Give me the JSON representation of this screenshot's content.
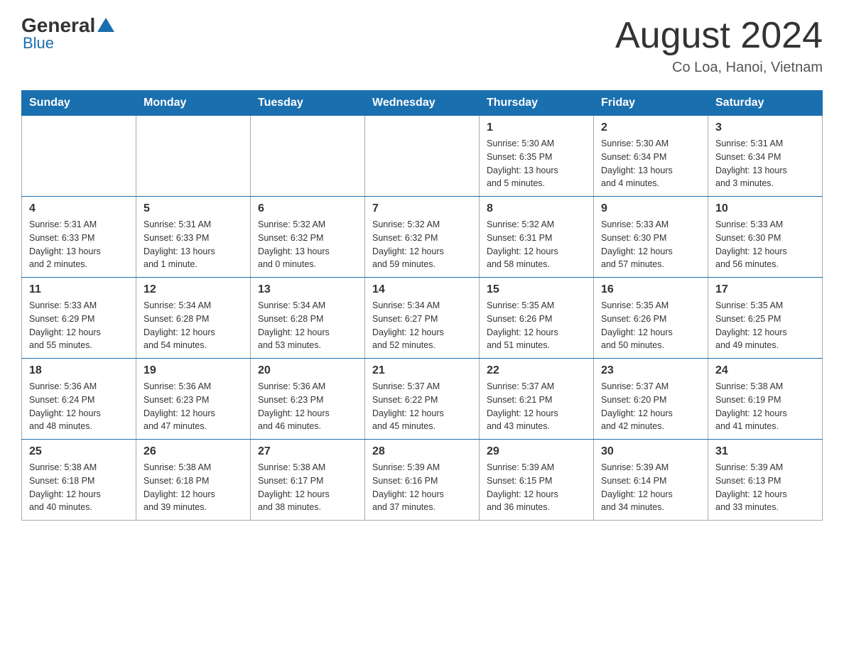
{
  "header": {
    "logo_general": "General",
    "logo_blue": "Blue",
    "month_title": "August 2024",
    "location": "Co Loa, Hanoi, Vietnam"
  },
  "days_of_week": [
    "Sunday",
    "Monday",
    "Tuesday",
    "Wednesday",
    "Thursday",
    "Friday",
    "Saturday"
  ],
  "weeks": [
    [
      {
        "day": "",
        "info": ""
      },
      {
        "day": "",
        "info": ""
      },
      {
        "day": "",
        "info": ""
      },
      {
        "day": "",
        "info": ""
      },
      {
        "day": "1",
        "info": "Sunrise: 5:30 AM\nSunset: 6:35 PM\nDaylight: 13 hours\nand 5 minutes."
      },
      {
        "day": "2",
        "info": "Sunrise: 5:30 AM\nSunset: 6:34 PM\nDaylight: 13 hours\nand 4 minutes."
      },
      {
        "day": "3",
        "info": "Sunrise: 5:31 AM\nSunset: 6:34 PM\nDaylight: 13 hours\nand 3 minutes."
      }
    ],
    [
      {
        "day": "4",
        "info": "Sunrise: 5:31 AM\nSunset: 6:33 PM\nDaylight: 13 hours\nand 2 minutes."
      },
      {
        "day": "5",
        "info": "Sunrise: 5:31 AM\nSunset: 6:33 PM\nDaylight: 13 hours\nand 1 minute."
      },
      {
        "day": "6",
        "info": "Sunrise: 5:32 AM\nSunset: 6:32 PM\nDaylight: 13 hours\nand 0 minutes."
      },
      {
        "day": "7",
        "info": "Sunrise: 5:32 AM\nSunset: 6:32 PM\nDaylight: 12 hours\nand 59 minutes."
      },
      {
        "day": "8",
        "info": "Sunrise: 5:32 AM\nSunset: 6:31 PM\nDaylight: 12 hours\nand 58 minutes."
      },
      {
        "day": "9",
        "info": "Sunrise: 5:33 AM\nSunset: 6:30 PM\nDaylight: 12 hours\nand 57 minutes."
      },
      {
        "day": "10",
        "info": "Sunrise: 5:33 AM\nSunset: 6:30 PM\nDaylight: 12 hours\nand 56 minutes."
      }
    ],
    [
      {
        "day": "11",
        "info": "Sunrise: 5:33 AM\nSunset: 6:29 PM\nDaylight: 12 hours\nand 55 minutes."
      },
      {
        "day": "12",
        "info": "Sunrise: 5:34 AM\nSunset: 6:28 PM\nDaylight: 12 hours\nand 54 minutes."
      },
      {
        "day": "13",
        "info": "Sunrise: 5:34 AM\nSunset: 6:28 PM\nDaylight: 12 hours\nand 53 minutes."
      },
      {
        "day": "14",
        "info": "Sunrise: 5:34 AM\nSunset: 6:27 PM\nDaylight: 12 hours\nand 52 minutes."
      },
      {
        "day": "15",
        "info": "Sunrise: 5:35 AM\nSunset: 6:26 PM\nDaylight: 12 hours\nand 51 minutes."
      },
      {
        "day": "16",
        "info": "Sunrise: 5:35 AM\nSunset: 6:26 PM\nDaylight: 12 hours\nand 50 minutes."
      },
      {
        "day": "17",
        "info": "Sunrise: 5:35 AM\nSunset: 6:25 PM\nDaylight: 12 hours\nand 49 minutes."
      }
    ],
    [
      {
        "day": "18",
        "info": "Sunrise: 5:36 AM\nSunset: 6:24 PM\nDaylight: 12 hours\nand 48 minutes."
      },
      {
        "day": "19",
        "info": "Sunrise: 5:36 AM\nSunset: 6:23 PM\nDaylight: 12 hours\nand 47 minutes."
      },
      {
        "day": "20",
        "info": "Sunrise: 5:36 AM\nSunset: 6:23 PM\nDaylight: 12 hours\nand 46 minutes."
      },
      {
        "day": "21",
        "info": "Sunrise: 5:37 AM\nSunset: 6:22 PM\nDaylight: 12 hours\nand 45 minutes."
      },
      {
        "day": "22",
        "info": "Sunrise: 5:37 AM\nSunset: 6:21 PM\nDaylight: 12 hours\nand 43 minutes."
      },
      {
        "day": "23",
        "info": "Sunrise: 5:37 AM\nSunset: 6:20 PM\nDaylight: 12 hours\nand 42 minutes."
      },
      {
        "day": "24",
        "info": "Sunrise: 5:38 AM\nSunset: 6:19 PM\nDaylight: 12 hours\nand 41 minutes."
      }
    ],
    [
      {
        "day": "25",
        "info": "Sunrise: 5:38 AM\nSunset: 6:18 PM\nDaylight: 12 hours\nand 40 minutes."
      },
      {
        "day": "26",
        "info": "Sunrise: 5:38 AM\nSunset: 6:18 PM\nDaylight: 12 hours\nand 39 minutes."
      },
      {
        "day": "27",
        "info": "Sunrise: 5:38 AM\nSunset: 6:17 PM\nDaylight: 12 hours\nand 38 minutes."
      },
      {
        "day": "28",
        "info": "Sunrise: 5:39 AM\nSunset: 6:16 PM\nDaylight: 12 hours\nand 37 minutes."
      },
      {
        "day": "29",
        "info": "Sunrise: 5:39 AM\nSunset: 6:15 PM\nDaylight: 12 hours\nand 36 minutes."
      },
      {
        "day": "30",
        "info": "Sunrise: 5:39 AM\nSunset: 6:14 PM\nDaylight: 12 hours\nand 34 minutes."
      },
      {
        "day": "31",
        "info": "Sunrise: 5:39 AM\nSunset: 6:13 PM\nDaylight: 12 hours\nand 33 minutes."
      }
    ]
  ]
}
